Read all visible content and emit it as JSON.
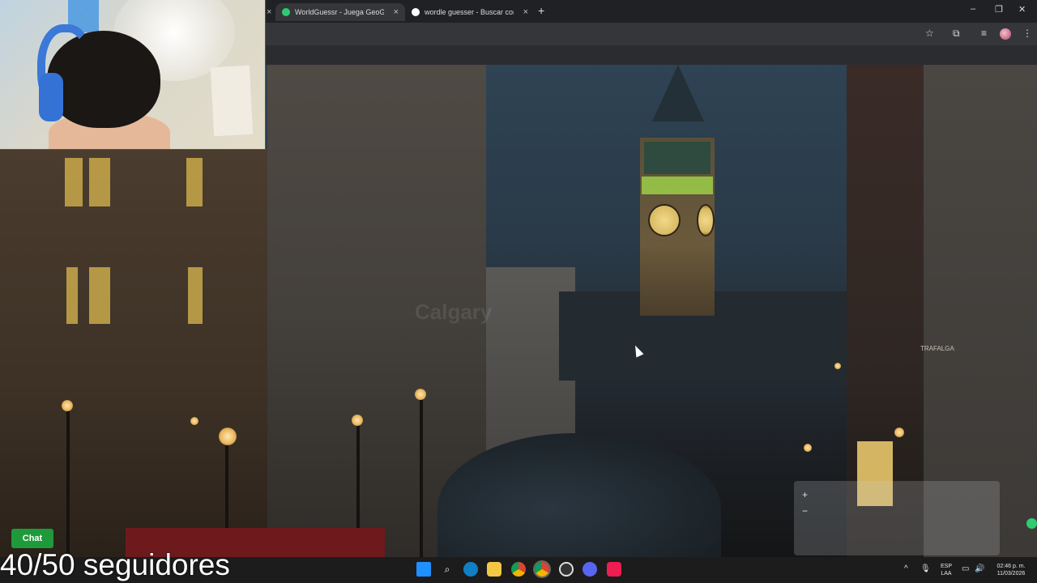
{
  "browser": {
    "tabs": [
      {
        "title": "WorldGuessr - Juega GeoGuessr",
        "favicon_color": "#2ecc71",
        "active": true
      },
      {
        "title": "wordle guesser - Buscar con Google",
        "favicon_color": "#ffffff",
        "active": false
      }
    ],
    "tab_close": "×",
    "new_tab": "+",
    "window_controls": {
      "minimize": "–",
      "maximize": "❐",
      "close": "✕"
    },
    "toolbar_icons": [
      "star-icon",
      "extensions-icon",
      "media-icon",
      "profile-avatar",
      "menu-icon"
    ],
    "toolbar_glyphs": {
      "star": "☆",
      "extensions": "⧉",
      "media": "≡",
      "menu": "⋮"
    }
  },
  "game": {
    "sign_text": "TRAFALGA",
    "watermark": "Calgary",
    "map": {
      "zoom_in": "+",
      "zoom_out": "−"
    }
  },
  "overlay": {
    "chat_label": "Chat",
    "followers": "40/50 seguidores"
  },
  "taskbar": {
    "icons": [
      "windows-start-icon",
      "search-icon",
      "edge-icon",
      "file-explorer-icon",
      "chrome-icon",
      "chrome-alt-icon",
      "obs-icon",
      "discord-icon",
      "tiktok-icon"
    ],
    "language_top": "ESP",
    "language_bottom": "LAA",
    "time": "02:46 p. m.",
    "date": "11/03/2026",
    "tray_glyphs": {
      "chevron": "^",
      "mic": "🎙",
      "display": "▭",
      "volume": "🔊"
    }
  }
}
